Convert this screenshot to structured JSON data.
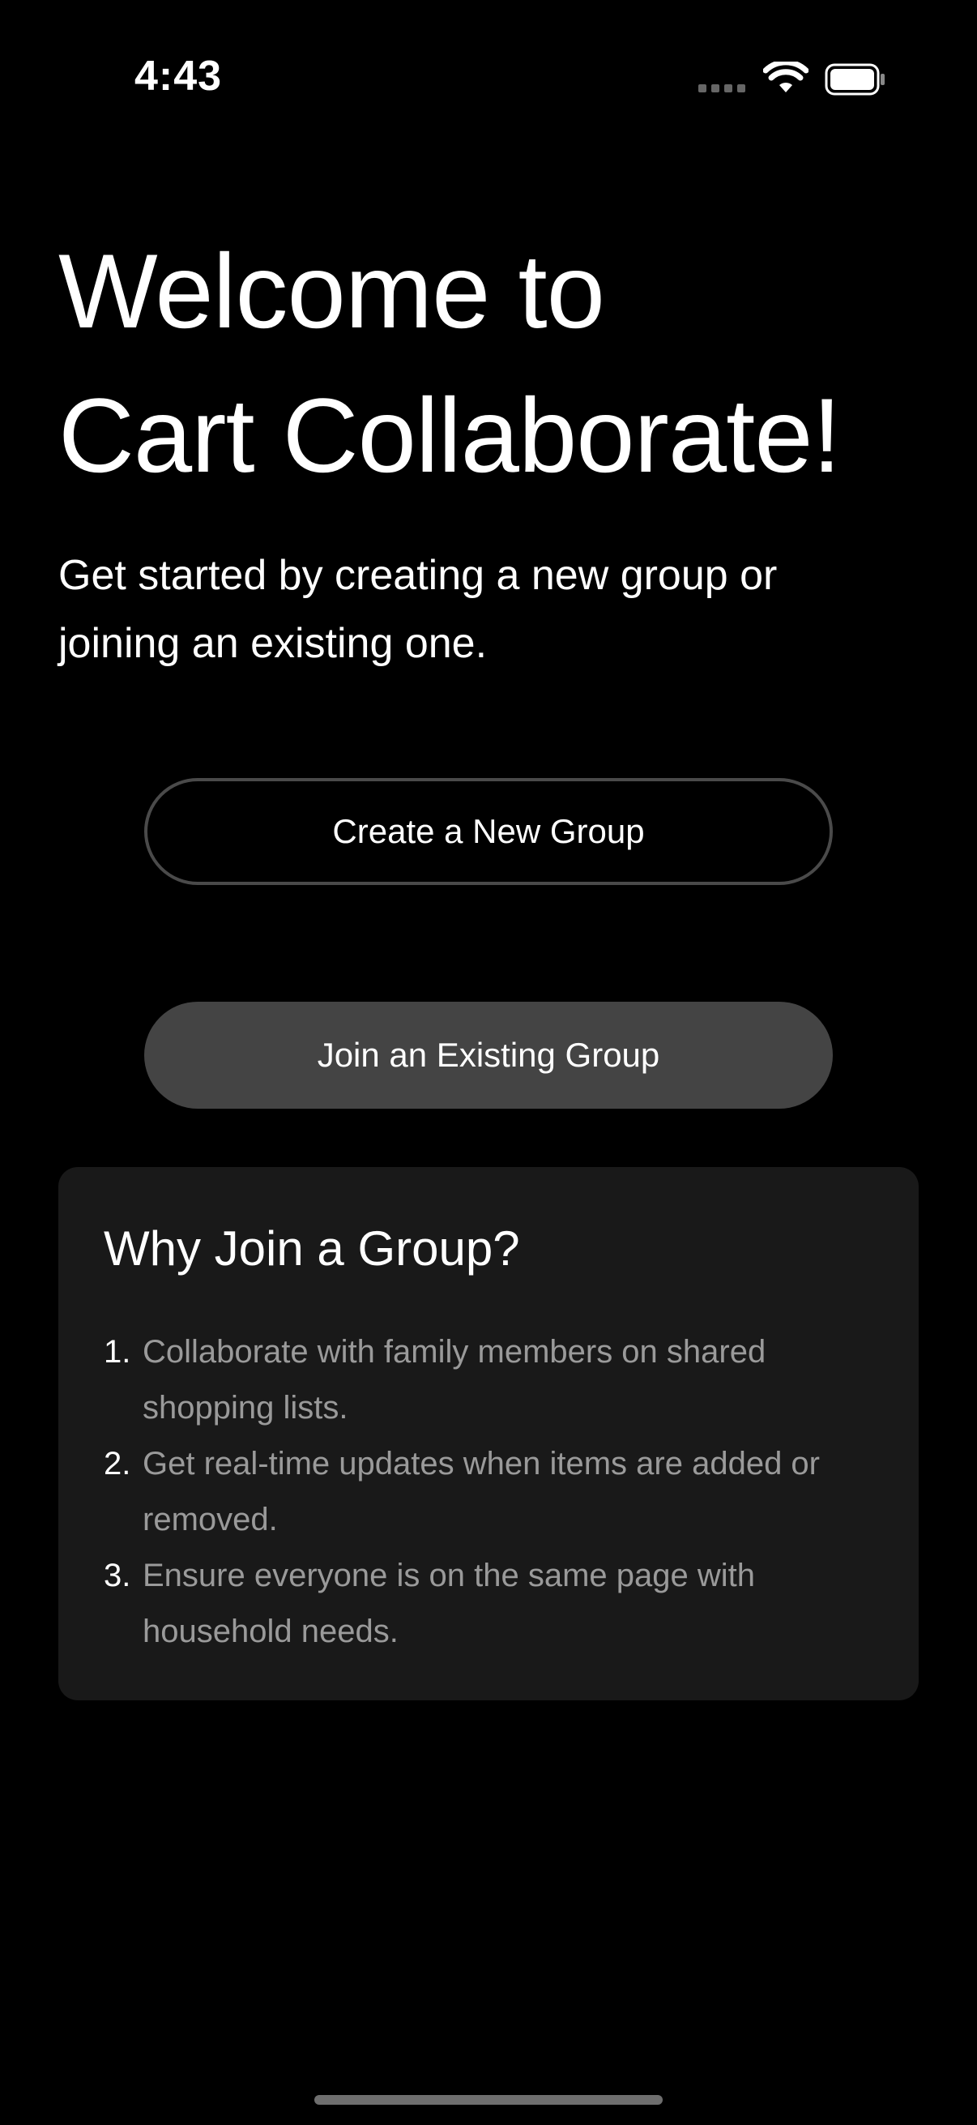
{
  "status_bar": {
    "time": "4:43",
    "icons": [
      "cellular-signal-icon",
      "wifi-icon",
      "battery-icon"
    ]
  },
  "welcome": {
    "title_line1": "Welcome to",
    "title_line2": "Cart Collaborate!",
    "subtitle": "Get started by creating a new group or joining an existing one."
  },
  "actions": {
    "create_label": "Create a New Group",
    "join_label": "Join an Existing Group"
  },
  "info": {
    "title": "Why Join a Group?",
    "reasons": [
      {
        "num": "1.",
        "text": "Collaborate with family members on shared shopping lists."
      },
      {
        "num": "2.",
        "text": "Get real-time updates when items are added or removed."
      },
      {
        "num": "3.",
        "text": "Ensure everyone is on the same page with household needs."
      }
    ]
  },
  "colors": {
    "background": "#000000",
    "card": "#191919",
    "button_filled": "#444444",
    "button_outline_border": "#4a4a4a",
    "secondary_text": "#9a9a9a"
  }
}
